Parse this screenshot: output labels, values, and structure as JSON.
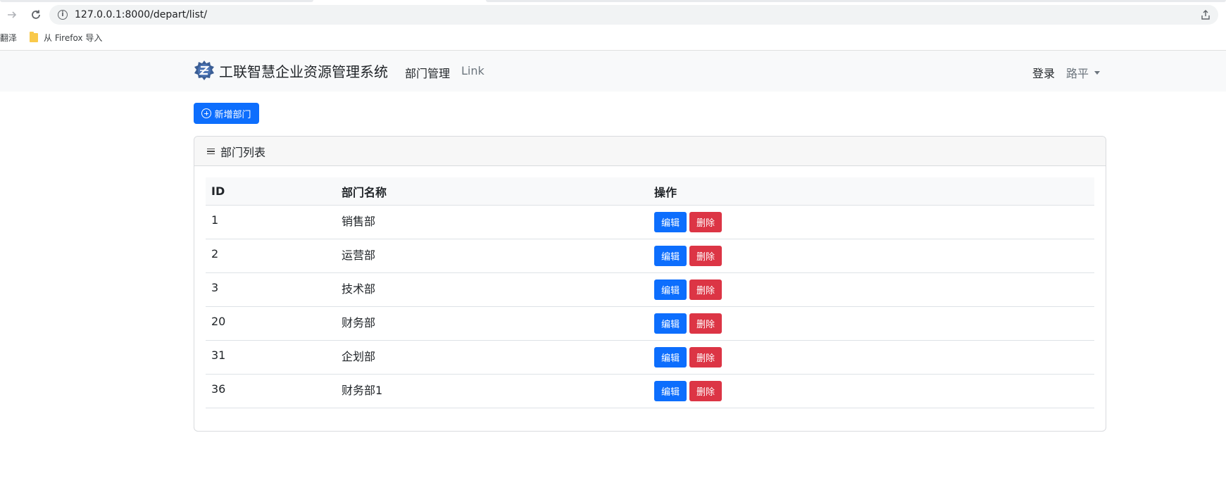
{
  "browser": {
    "url": "127.0.0.1:8000/depart/list/",
    "bookmarks_cut": "翻泽",
    "bookmark_folder": "从 Firefox 导入"
  },
  "navbar": {
    "brand": "工联智慧企业资源管理系统",
    "links": [
      "部门管理",
      "Link"
    ],
    "login": "登录",
    "user": "路平"
  },
  "main": {
    "add_button": "新增部门",
    "card_title": "部门列表",
    "table": {
      "headers": [
        "ID",
        "部门名称",
        "操作"
      ],
      "rows": [
        {
          "id": "1",
          "name": "销售部"
        },
        {
          "id": "2",
          "name": "运营部"
        },
        {
          "id": "3",
          "name": "技术部"
        },
        {
          "id": "20",
          "name": "财务部"
        },
        {
          "id": "31",
          "name": "企划部"
        },
        {
          "id": "36",
          "name": "财务部1"
        }
      ],
      "edit_label": "编辑",
      "delete_label": "删除"
    }
  },
  "colors": {
    "primary": "#0d6efd",
    "danger": "#dc3545",
    "navbar_bg": "#f8f9fa"
  }
}
